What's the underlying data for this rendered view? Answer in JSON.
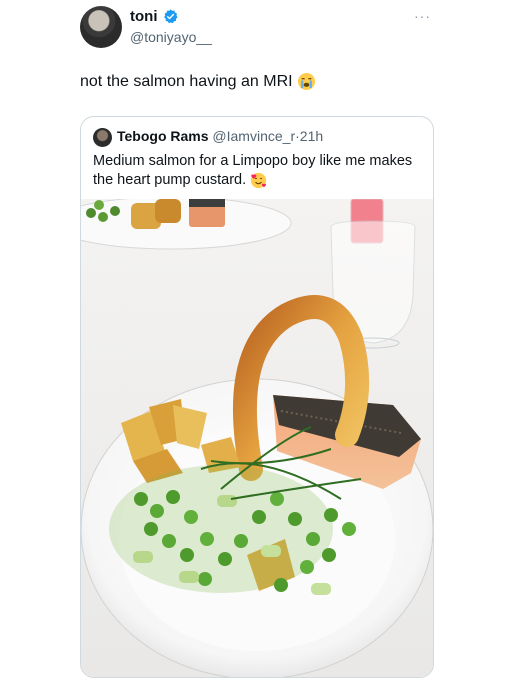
{
  "tweet": {
    "name": "toni",
    "handle": "@toniyayo__",
    "more": "···",
    "text": "not the salmon having an MRI",
    "emoji": "loudly-crying-face-icon"
  },
  "quoted_tweet": {
    "name": "Tebogo Rams",
    "handle": "@Iamvince_r",
    "separator": "·",
    "time": "21h",
    "text": "Medium salmon for a Limpopo boy like me makes the heart pump custard.",
    "emoji": "smiling-face-with-hearts-icon"
  },
  "colors": {
    "verified": "#1d9bf0",
    "handle_text": "#536471",
    "border": "#cfd9de"
  }
}
